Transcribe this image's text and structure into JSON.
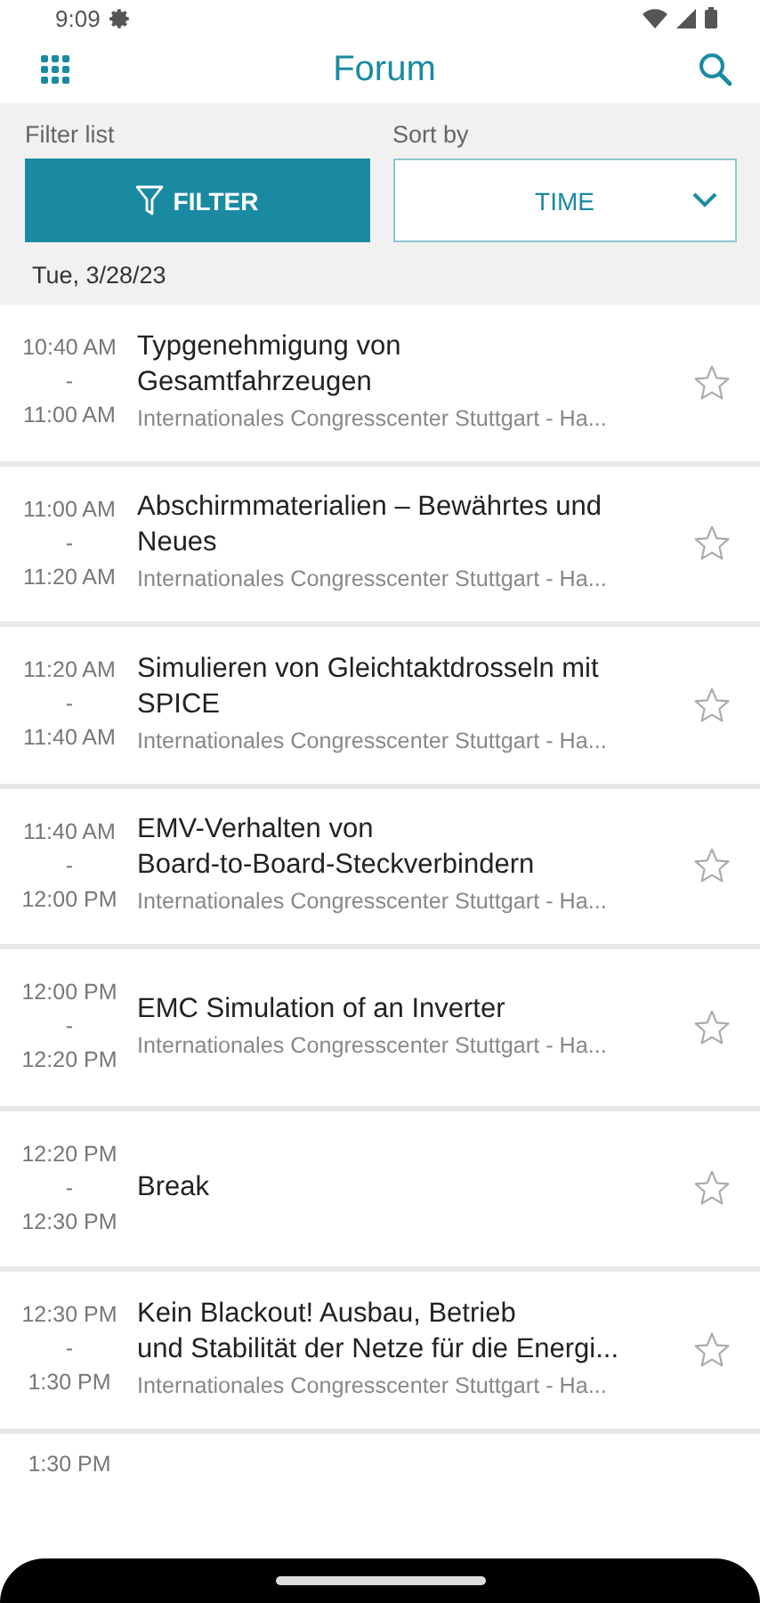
{
  "status_bar": {
    "time": "9:09"
  },
  "header": {
    "title": "Forum"
  },
  "filter": {
    "label": "Filter list",
    "button": "FILTER"
  },
  "sort": {
    "label": "Sort by",
    "value": "TIME"
  },
  "date": "Tue, 3/28/23",
  "sessions": [
    {
      "start": "10:40 AM",
      "separator": "-",
      "end": "11:00 AM",
      "title": "Typgenehmigung von\nGesamtfahrzeugen",
      "venue": "Internationales Congresscenter Stuttgart - Ha...",
      "starred": false
    },
    {
      "start": "11:00 AM",
      "separator": "-",
      "end": "11:20 AM",
      "title": "Abschirmmaterialien – Bewährtes und\nNeues",
      "venue": "Internationales Congresscenter Stuttgart - Ha...",
      "starred": false
    },
    {
      "start": "11:20 AM",
      "separator": "-",
      "end": "11:40 AM",
      "title": "Simulieren von Gleichtaktdrosseln mit\nSPICE",
      "venue": "Internationales Congresscenter Stuttgart - Ha...",
      "starred": false
    },
    {
      "start": "11:40 AM",
      "separator": "-",
      "end": "12:00 PM",
      "title": "EMV-Verhalten von\nBoard-to-Board-Steckverbindern",
      "venue": "Internationales Congresscenter Stuttgart - Ha...",
      "starred": false
    },
    {
      "start": "12:00 PM",
      "separator": "-",
      "end": "12:20 PM",
      "title": "EMC Simulation of an Inverter",
      "venue": "Internationales Congresscenter Stuttgart - Ha...",
      "starred": false
    },
    {
      "start": "12:20 PM",
      "separator": "-",
      "end": "12:30 PM",
      "title": "Break",
      "starred": false
    },
    {
      "start": "12:30 PM",
      "separator": "-",
      "end": "1:30 PM",
      "title": "Kein Blackout!  Ausbau, Betrieb\nund Stabilität der Netze für die Energi...",
      "venue": "Internationales Congresscenter Stuttgart - Ha...",
      "starred": false
    }
  ],
  "partial_session": {
    "start": "1:30 PM"
  }
}
